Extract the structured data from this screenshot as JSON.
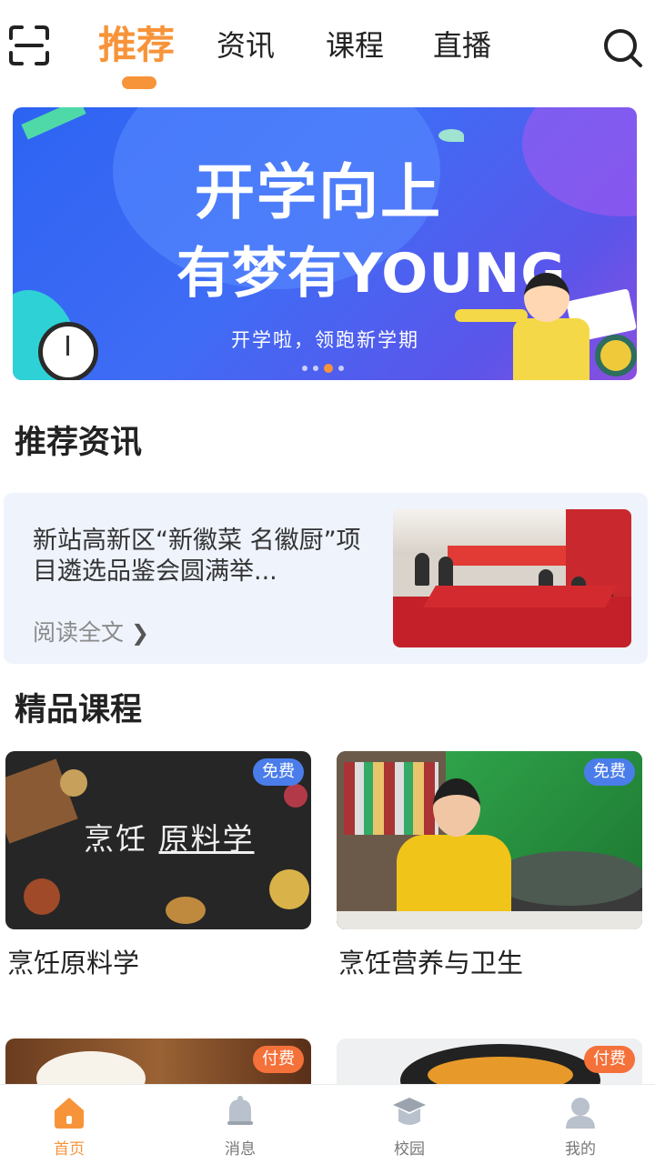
{
  "header": {
    "tabs": [
      {
        "label": "推荐",
        "active": true
      },
      {
        "label": "资讯",
        "active": false
      },
      {
        "label": "课程",
        "active": false
      },
      {
        "label": "直播",
        "active": false
      }
    ],
    "scan_icon": "scan-icon",
    "search_icon": "search-icon",
    "accent_color": "#f7943a"
  },
  "banner": {
    "title_line1": "开学向上",
    "title_line2": "有梦有YOUNG",
    "subtitle": "开学啦，领跑新学期",
    "slide_count": 4,
    "active_slide": 3
  },
  "news_section": {
    "title": "推荐资讯",
    "item": {
      "title": "新站高新区“新徽菜 名徽厨”项目遴选品鉴会圆满举...",
      "read_more": "阅读全文"
    }
  },
  "course_section": {
    "title": "精品课程",
    "courses": [
      {
        "title": "烹饪原料学",
        "badge": "免费",
        "image_text_a": "烹饪",
        "image_text_b": "原料学"
      },
      {
        "title": "烹饪营养与卫生",
        "badge": "免费"
      },
      {
        "title": "",
        "badge": "付费"
      },
      {
        "title": "",
        "badge": "付费"
      }
    ],
    "free_color": "#4a7dea",
    "paid_color": "#f5713a"
  },
  "bottom_nav": {
    "items": [
      {
        "label": "首页",
        "icon": "home-icon",
        "active": true
      },
      {
        "label": "消息",
        "icon": "bell-icon",
        "active": false
      },
      {
        "label": "校园",
        "icon": "campus-icon",
        "active": false
      },
      {
        "label": "我的",
        "icon": "profile-icon",
        "active": false
      }
    ]
  }
}
